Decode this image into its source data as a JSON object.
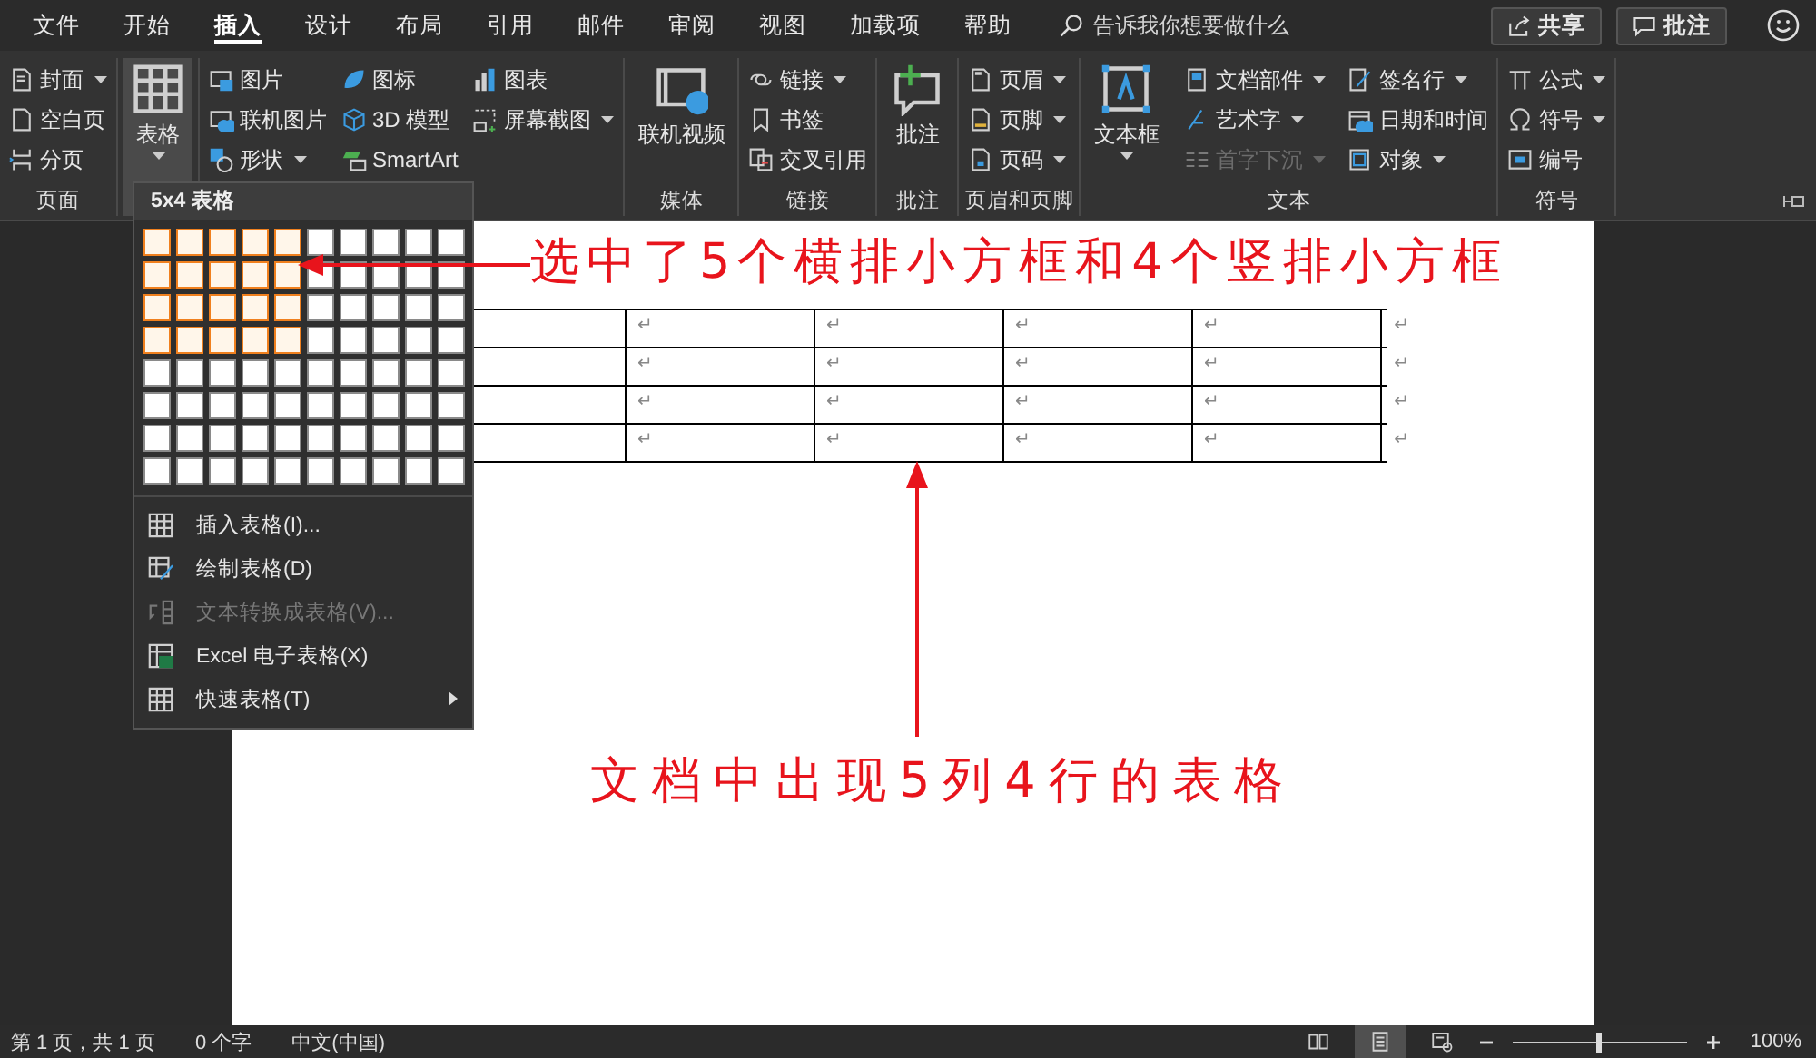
{
  "menu_tabs": [
    {
      "label": "文件",
      "selected": false
    },
    {
      "label": "开始",
      "selected": false
    },
    {
      "label": "插入",
      "selected": true
    },
    {
      "label": "设计",
      "selected": false
    },
    {
      "label": "布局",
      "selected": false
    },
    {
      "label": "引用",
      "selected": false
    },
    {
      "label": "邮件",
      "selected": false
    },
    {
      "label": "审阅",
      "selected": false
    },
    {
      "label": "视图",
      "selected": false
    },
    {
      "label": "加载项",
      "selected": false
    },
    {
      "label": "帮助",
      "selected": false
    }
  ],
  "search": {
    "placeholder": "告诉我你想要做什么"
  },
  "top_buttons": [
    "共享",
    "批注"
  ],
  "ribbon": {
    "groups": [
      {
        "label": "页面",
        "parts": [
          {
            "kind": "column",
            "items": [
              {
                "label": "封面",
                "dropdown": true
              },
              {
                "label": "空白页",
                "dropdown": false
              },
              {
                "label": "分页",
                "dropdown": false
              }
            ]
          }
        ]
      },
      {
        "parts": [
          {
            "kind": "large",
            "label": "表格",
            "dropdown": true,
            "expanded": true
          }
        ]
      },
      {
        "parts": [
          {
            "kind": "column",
            "items": [
              {
                "label": "图片",
                "dropdown": false
              },
              {
                "label": "联机图片",
                "dropdown": false
              },
              {
                "label": "形状",
                "dropdown": true
              }
            ]
          },
          {
            "kind": "column",
            "items": [
              {
                "label": "图标",
                "dropdown": false
              },
              {
                "label": "3D 模型",
                "dropdown": false
              },
              {
                "label": "SmartArt",
                "dropdown": false
              }
            ]
          },
          {
            "kind": "column",
            "items": [
              {
                "label": "图表",
                "dropdown": false
              },
              {
                "label": "屏幕截图",
                "dropdown": true
              }
            ]
          }
        ]
      },
      {
        "label": "媒体",
        "parts": [
          {
            "kind": "large",
            "label": "联机视频",
            "dropdown": false,
            "expanded": false
          }
        ]
      },
      {
        "label": "链接",
        "parts": [
          {
            "kind": "column",
            "items": [
              {
                "label": "链接",
                "dropdown": true
              },
              {
                "label": "书签",
                "dropdown": false
              },
              {
                "label": "交叉引用",
                "dropdown": false
              }
            ]
          }
        ]
      },
      {
        "label": "批注",
        "parts": [
          {
            "kind": "large",
            "label": "批注",
            "dropdown": false,
            "expanded": false
          }
        ]
      },
      {
        "label": "页眉和页脚",
        "parts": [
          {
            "kind": "column",
            "items": [
              {
                "label": "页眉",
                "dropdown": true
              },
              {
                "label": "页脚",
                "dropdown": true
              },
              {
                "label": "页码",
                "dropdown": true
              }
            ]
          }
        ]
      },
      {
        "label": "文本",
        "parts": [
          {
            "kind": "large",
            "label": "文本框",
            "dropdown": true,
            "expanded": false
          },
          {
            "kind": "column",
            "items": [
              {
                "label": "文档部件",
                "dropdown": true,
                "disabled": false
              },
              {
                "label": "艺术字",
                "dropdown": true,
                "disabled": false
              },
              {
                "label": "首字下沉",
                "dropdown": true,
                "disabled": true
              }
            ]
          },
          {
            "kind": "column",
            "items": [
              {
                "label": "签名行",
                "dropdown": true
              },
              {
                "label": "日期和时间",
                "dropdown": false
              },
              {
                "label": "对象",
                "dropdown": true
              }
            ]
          }
        ]
      },
      {
        "label": "符号",
        "parts": [
          {
            "kind": "column",
            "items": [
              {
                "label": "公式",
                "dropdown": true
              },
              {
                "label": "符号",
                "dropdown": true
              },
              {
                "label": "编号",
                "dropdown": false
              }
            ]
          }
        ]
      }
    ]
  },
  "table_dropdown": {
    "title": "5x4 表格",
    "grid": [
      {
        "cells": [
          {
            "selected": true
          },
          {
            "selected": true
          },
          {
            "selected": true
          },
          {
            "selected": true
          },
          {
            "selected": true
          },
          {
            "selected": false
          },
          {
            "selected": false
          },
          {
            "selected": false
          },
          {
            "selected": false
          },
          {
            "selected": false
          }
        ]
      },
      {
        "cells": [
          {
            "selected": true
          },
          {
            "selected": true
          },
          {
            "selected": true
          },
          {
            "selected": true
          },
          {
            "selected": true
          },
          {
            "selected": false
          },
          {
            "selected": false
          },
          {
            "selected": false
          },
          {
            "selected": false
          },
          {
            "selected": false
          }
        ]
      },
      {
        "cells": [
          {
            "selected": true
          },
          {
            "selected": true
          },
          {
            "selected": true
          },
          {
            "selected": true
          },
          {
            "selected": true
          },
          {
            "selected": false
          },
          {
            "selected": false
          },
          {
            "selected": false
          },
          {
            "selected": false
          },
          {
            "selected": false
          }
        ]
      },
      {
        "cells": [
          {
            "selected": true
          },
          {
            "selected": true
          },
          {
            "selected": true
          },
          {
            "selected": true
          },
          {
            "selected": true
          },
          {
            "selected": false
          },
          {
            "selected": false
          },
          {
            "selected": false
          },
          {
            "selected": false
          },
          {
            "selected": false
          }
        ]
      },
      {
        "cells": [
          {
            "selected": false
          },
          {
            "selected": false
          },
          {
            "selected": false
          },
          {
            "selected": false
          },
          {
            "selected": false
          },
          {
            "selected": false
          },
          {
            "selected": false
          },
          {
            "selected": false
          },
          {
            "selected": false
          },
          {
            "selected": false
          }
        ]
      },
      {
        "cells": [
          {
            "selected": false
          },
          {
            "selected": false
          },
          {
            "selected": false
          },
          {
            "selected": false
          },
          {
            "selected": false
          },
          {
            "selected": false
          },
          {
            "selected": false
          },
          {
            "selected": false
          },
          {
            "selected": false
          },
          {
            "selected": false
          }
        ]
      },
      {
        "cells": [
          {
            "selected": false
          },
          {
            "selected": false
          },
          {
            "selected": false
          },
          {
            "selected": false
          },
          {
            "selected": false
          },
          {
            "selected": false
          },
          {
            "selected": false
          },
          {
            "selected": false
          },
          {
            "selected": false
          },
          {
            "selected": false
          }
        ]
      },
      {
        "cells": [
          {
            "selected": false
          },
          {
            "selected": false
          },
          {
            "selected": false
          },
          {
            "selected": false
          },
          {
            "selected": false
          },
          {
            "selected": false
          },
          {
            "selected": false
          },
          {
            "selected": false
          },
          {
            "selected": false
          },
          {
            "selected": false
          }
        ]
      }
    ],
    "items": [
      {
        "label": "插入表格(I)...",
        "disabled": false,
        "submenu": false
      },
      {
        "label": "绘制表格(D)",
        "disabled": false,
        "submenu": false
      },
      {
        "label": "文本转换成表格(V)...",
        "disabled": true,
        "submenu": false
      },
      {
        "label": "Excel 电子表格(X)",
        "disabled": false,
        "submenu": false
      },
      {
        "label": "快速表格(T)",
        "disabled": false,
        "submenu": true
      }
    ]
  },
  "document_table": {
    "rows": [
      {
        "cells": [
          "↵",
          "↵",
          "↵",
          "↵"
        ],
        "end_mark": "↵"
      },
      {
        "cells": [
          "↵",
          "↵",
          "↵",
          "↵"
        ],
        "end_mark": "↵"
      },
      {
        "cells": [
          "↵",
          "↵",
          "↵",
          "↵"
        ],
        "end_mark": "↵"
      },
      {
        "cells": [
          "↵",
          "↵",
          "↵",
          "↵"
        ],
        "end_mark": "↵"
      }
    ]
  },
  "annotations": [
    {
      "kind": "left-arrow",
      "text": "选中了5个横排小方框和4个竖排小方框"
    },
    {
      "kind": "up-arrow",
      "text": "文档中出现5列4行的表格"
    }
  ],
  "status_bar": {
    "texts": [
      "第 1 页，共 1 页",
      "0 个字",
      "中文(中国)"
    ],
    "views": [
      {
        "selected": false
      },
      {
        "selected": true
      },
      {
        "selected": false
      }
    ],
    "zoom": {
      "level": 0.5,
      "reading": "100%"
    }
  }
}
